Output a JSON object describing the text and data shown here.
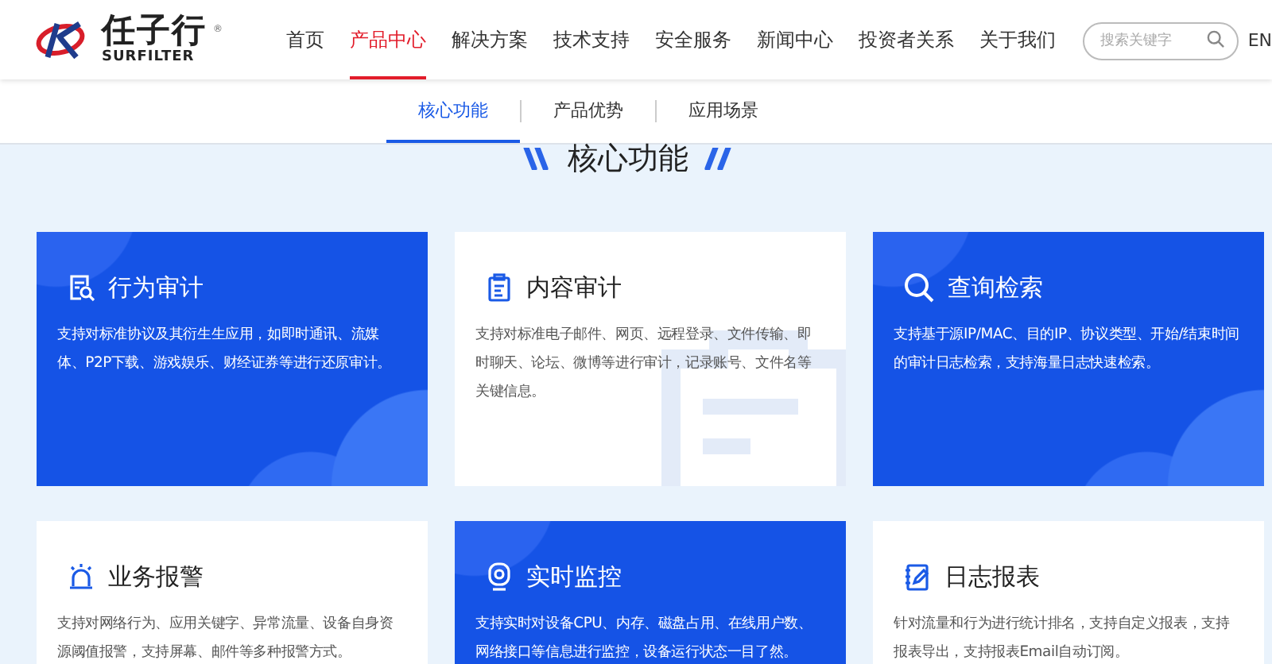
{
  "logo": {
    "name": "任子行",
    "sub": "SURFILTER",
    "mark": "®"
  },
  "nav": [
    {
      "label": "首页",
      "selected": false
    },
    {
      "label": "产品中心",
      "selected": true
    },
    {
      "label": "解决方案",
      "selected": false
    },
    {
      "label": "技术支持",
      "selected": false
    },
    {
      "label": "安全服务",
      "selected": false
    },
    {
      "label": "新闻中心",
      "selected": false
    },
    {
      "label": "投资者关系",
      "selected": false
    },
    {
      "label": "关于我们",
      "selected": false
    }
  ],
  "search": {
    "placeholder": "搜索关键字"
  },
  "language": "EN",
  "subnav": [
    {
      "label": "核心功能",
      "selected": true
    },
    {
      "label": "产品优势",
      "selected": false
    },
    {
      "label": "应用场景",
      "selected": false
    }
  ],
  "section_title": "核心功能",
  "cards": [
    {
      "kind": "featured",
      "title": "行为审计",
      "text": "支持对标准协议及其衍生生应用，如即时通讯、流媒体、P2P下载、游戏娱乐、财经证券等进行还原审计。"
    },
    {
      "kind": "plain",
      "title": "内容审计",
      "text": "支持对标准电子邮件、网页、远程登录、文件传输、即时聊天、论坛、微博等进行审计，记录账号、文件名等关键信息。"
    },
    {
      "kind": "featured",
      "title": "查询检索",
      "text": "支持基于源IP/MAC、目的IP、协议类型、开始/结束时间的审计日志检索，支持海量日志快速检索。"
    },
    {
      "kind": "plain",
      "title": "业务报警",
      "text": "支持对网络行为、应用关键字、异常流量、设备自身资源阈值报警，支持屏幕、邮件等多种报警方式。"
    },
    {
      "kind": "featured",
      "title": "实时监控",
      "text": "支持实时对设备CPU、内存、磁盘占用、在线用户数、网络接口等信息进行监控，设备运行状态一目了然。"
    },
    {
      "kind": "plain",
      "title": "日志报表",
      "text": "针对流量和行为进行统计排名，支持自定义报表，支持报表导出，支持报表Email自动订阅。"
    }
  ]
}
